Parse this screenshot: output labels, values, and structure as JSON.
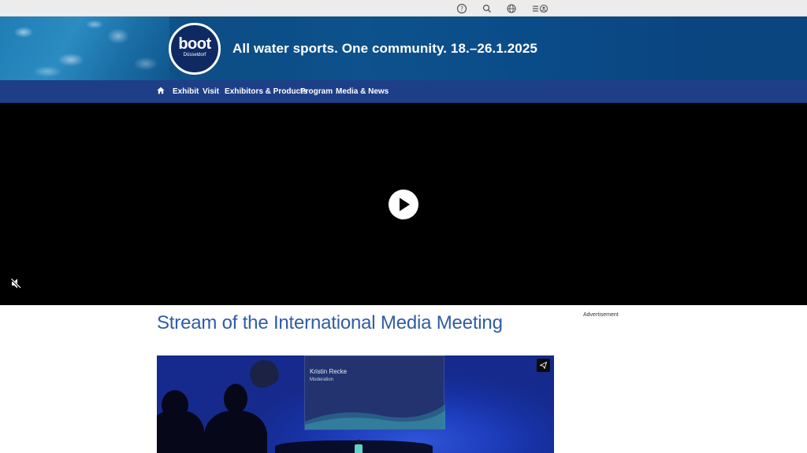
{
  "topbar": {
    "icons": [
      "help-icon",
      "search-icon",
      "globe-icon",
      "menu-user-icon"
    ]
  },
  "banner": {
    "logo_text": "boot",
    "logo_subtext": "Düsseldorf",
    "tagline": "All water sports. One community. 18.–26.1.2025"
  },
  "nav": {
    "home_icon": "home-icon",
    "items": [
      "Exhibit",
      "Visit",
      "Exhibitors & Products",
      "Program",
      "Media & News"
    ]
  },
  "video": {
    "play_icon": "play-icon",
    "mute_icon": "muted-speaker-icon"
  },
  "main": {
    "title": "Stream of the International Media Meeting",
    "advertisement_label": "Advertisement"
  },
  "thumbnail": {
    "speaker_name": "Kristin Recke",
    "speaker_role": "Moderation",
    "share_icon": "share-icon"
  },
  "colors": {
    "nav_bg": "#1e3f87",
    "title_color": "#2f5da5",
    "video_bg": "#000000"
  }
}
